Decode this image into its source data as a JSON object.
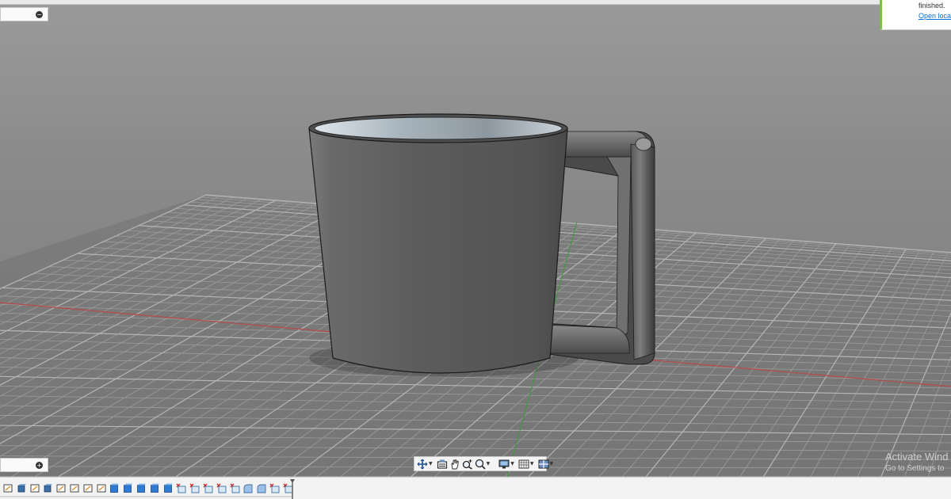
{
  "notification": {
    "message": "finished.",
    "link": "Open locat"
  },
  "watermark": {
    "line1": "Activate Wind",
    "line2": "Go to Settings to"
  },
  "panels": {
    "browser_toggle": "−",
    "comments_toggle": "+"
  },
  "navigation_toolbar": {
    "items": [
      {
        "name": "orbit",
        "icon": "orbit-icon",
        "has_dropdown": true
      },
      {
        "name": "look-at",
        "icon": "look-at-icon",
        "has_dropdown": false
      },
      {
        "name": "pan",
        "icon": "hand-pan-icon",
        "has_dropdown": false
      },
      {
        "name": "zoom",
        "icon": "zoom-icon",
        "has_dropdown": false
      },
      {
        "name": "fit",
        "icon": "fit-zoom-icon",
        "has_dropdown": true
      },
      {
        "name": "display-settings",
        "icon": "display-settings-icon",
        "has_dropdown": true
      },
      {
        "name": "grid-snaps",
        "icon": "grid-icon",
        "has_dropdown": true
      },
      {
        "name": "viewports",
        "icon": "viewports-icon",
        "has_dropdown": true
      }
    ]
  },
  "timeline": {
    "features": [
      {
        "type": "sketch"
      },
      {
        "type": "extrude"
      },
      {
        "type": "sketch"
      },
      {
        "type": "extrude"
      },
      {
        "type": "sketch"
      },
      {
        "type": "sketch"
      },
      {
        "type": "sketch"
      },
      {
        "type": "sketch"
      },
      {
        "type": "body"
      },
      {
        "type": "body"
      },
      {
        "type": "body"
      },
      {
        "type": "body"
      },
      {
        "type": "body"
      },
      {
        "type": "sketch-x"
      },
      {
        "type": "sketch-x"
      },
      {
        "type": "sketch-x"
      },
      {
        "type": "sketch-x"
      },
      {
        "type": "sketch-x"
      },
      {
        "type": "fillet"
      },
      {
        "type": "fillet"
      },
      {
        "type": "sketch-x"
      },
      {
        "type": "sketch-x"
      }
    ]
  },
  "colors": {
    "background_top": "#9a9a9a",
    "grid_x_axis": "#b84a4a",
    "grid_z_axis": "#3a9a3a",
    "mug_body": "#606060",
    "accent_link": "#0a6fd6",
    "notification_accent": "#7ac143"
  }
}
